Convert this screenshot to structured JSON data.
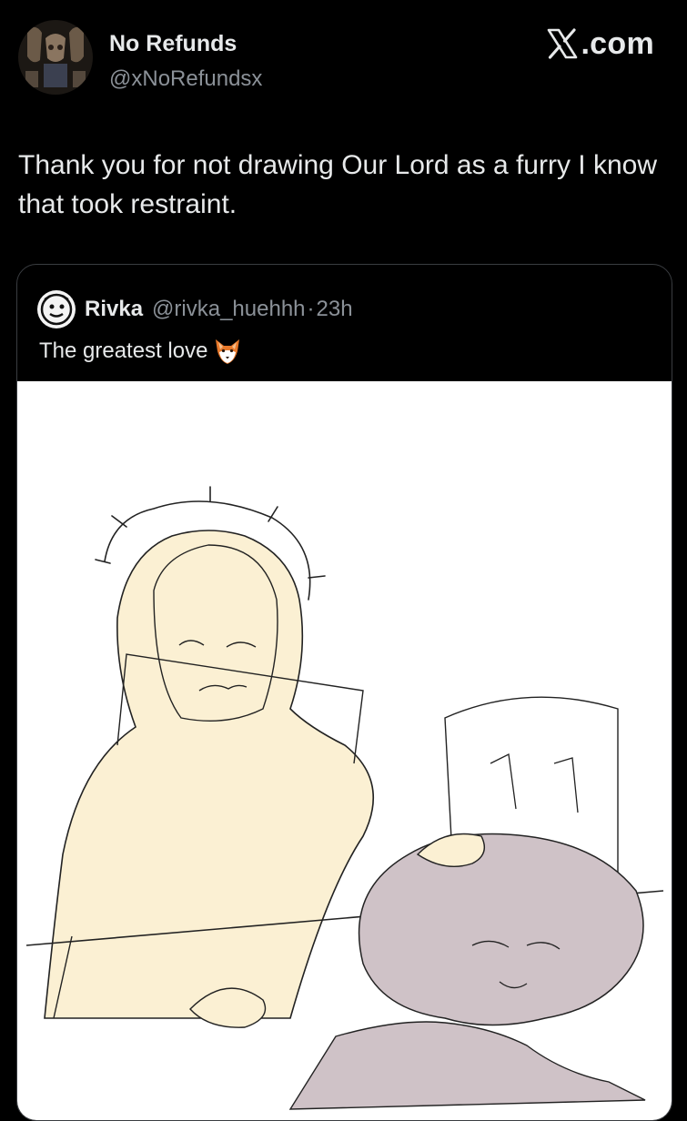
{
  "post": {
    "author": {
      "display_name": "No Refunds",
      "handle": "@xNoRefundsx"
    },
    "brand": {
      "suffix": ".com"
    },
    "text": "Thank you for not drawing Our Lord as a furry I know that took restraint."
  },
  "quoted_post": {
    "author": {
      "display_name": "Rivka",
      "handle": "@rivka_huehhh",
      "separator": "·",
      "time": "23h"
    },
    "text": "The greatest love",
    "emoji": "fox-face-icon"
  },
  "colors": {
    "background": "#000000",
    "primary_text": "#e7e9ea",
    "secondary_text": "#8b9198",
    "card_border": "#3a3d41",
    "robe_fill": "#fbf0d3",
    "fur_fill": "#cfc2c7"
  }
}
